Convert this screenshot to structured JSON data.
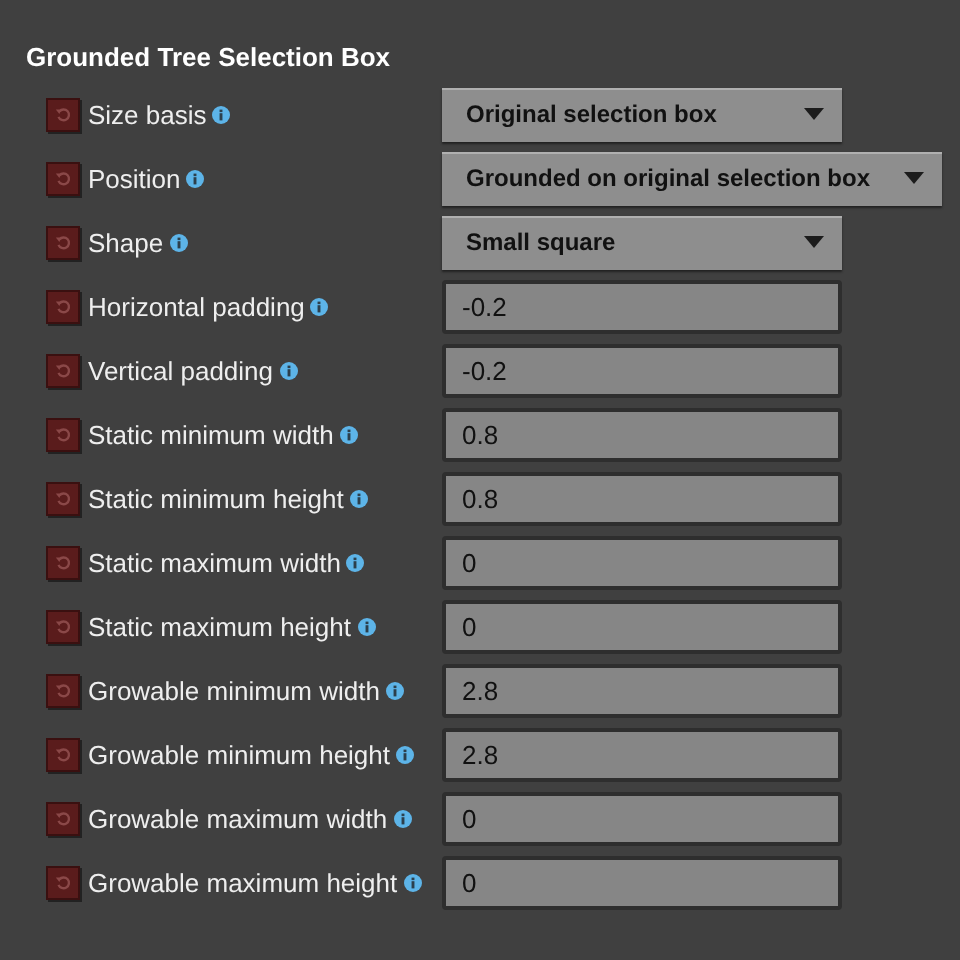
{
  "section": {
    "title": "Grounded Tree Selection Box"
  },
  "settings": [
    {
      "label": "Size basis",
      "kind": "dropdown",
      "value": "Original selection box"
    },
    {
      "label": "Position",
      "kind": "dropdown",
      "value": "Grounded on original selection box"
    },
    {
      "label": "Shape",
      "kind": "dropdown",
      "value": "Small square"
    },
    {
      "label": "Horizontal padding",
      "kind": "number",
      "value": "-0.2"
    },
    {
      "label": "Vertical padding",
      "kind": "number",
      "value": "-0.2"
    },
    {
      "label": "Static minimum width",
      "kind": "number",
      "value": "0.8"
    },
    {
      "label": "Static minimum height",
      "kind": "number",
      "value": "0.8"
    },
    {
      "label": "Static maximum width",
      "kind": "number",
      "value": "0"
    },
    {
      "label": "Static maximum height",
      "kind": "number",
      "value": "0"
    },
    {
      "label": "Growable minimum width",
      "kind": "number",
      "value": "2.8"
    },
    {
      "label": "Growable minimum height",
      "kind": "number",
      "value": "2.8"
    },
    {
      "label": "Growable maximum width",
      "kind": "number",
      "value": "0"
    },
    {
      "label": "Growable maximum height",
      "kind": "number",
      "value": "0"
    }
  ]
}
